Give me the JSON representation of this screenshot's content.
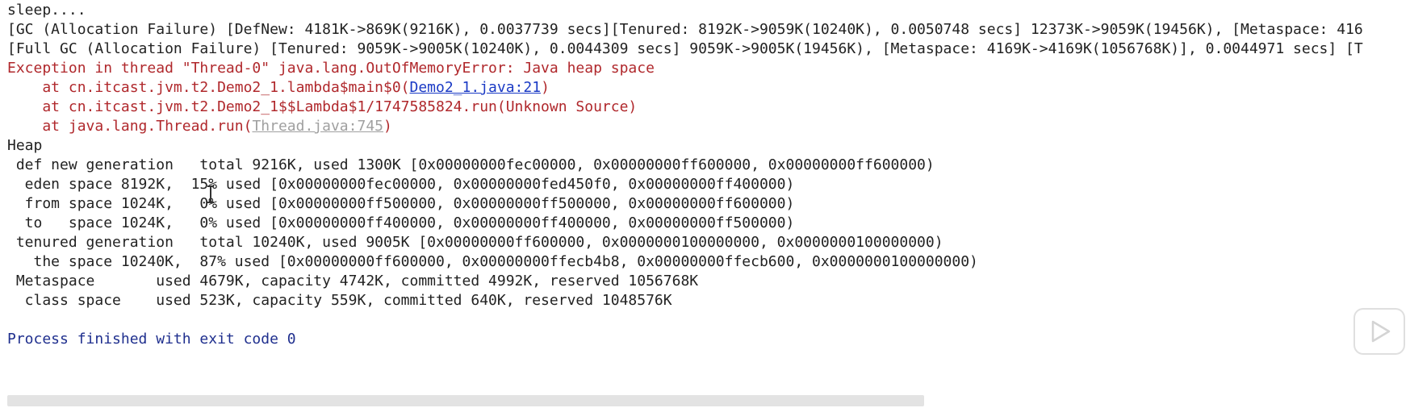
{
  "console": {
    "sleep": "sleep....",
    "gc1": "[GC (Allocation Failure) [DefNew: 4181K->869K(9216K), 0.0037739 secs][Tenured: 8192K->9059K(10240K), 0.0050748 secs] 12373K->9059K(19456K), [Metaspace: 416",
    "gc2": "[Full GC (Allocation Failure) [Tenured: 9059K->9005K(10240K), 0.0044309 secs] 9059K->9005K(19456K), [Metaspace: 4169K->4169K(1056768K)], 0.0044971 secs] [T",
    "exception": "Exception in thread \"Thread-0\" java.lang.OutOfMemoryError: Java heap space",
    "stack1_prefix": "    at cn.itcast.jvm.t2.Demo2_1.lambda$main$0(",
    "stack1_link": "Demo2_1.java:21",
    "stack1_suffix": ")",
    "stack2": "    at cn.itcast.jvm.t2.Demo2_1$$Lambda$1/1747585824.run(Unknown Source)",
    "stack3_prefix": "    at java.lang.Thread.run(",
    "stack3_link": "Thread.java:745",
    "stack3_suffix": ")",
    "heap": "Heap",
    "def_new": " def new generation   total 9216K, used 1300K [0x00000000fec00000, 0x00000000ff600000, 0x00000000ff600000)",
    "eden": "  eden space 8192K,  15% used [0x00000000fec00000, 0x00000000fed450f0, 0x00000000ff400000)",
    "from": "  from space 1024K,   0% used [0x00000000ff500000, 0x00000000ff500000, 0x00000000ff600000)",
    "to": "  to   space 1024K,   0% used [0x00000000ff400000, 0x00000000ff400000, 0x00000000ff500000)",
    "tenured": " tenured generation   total 10240K, used 9005K [0x00000000ff600000, 0x0000000100000000, 0x0000000100000000)",
    "the_space": "   the space 10240K,  87% used [0x00000000ff600000, 0x00000000ffecb4b8, 0x00000000ffecb600, 0x0000000100000000)",
    "metaspace": " Metaspace       used 4679K, capacity 4742K, committed 4992K, reserved 1056768K",
    "class_space": "  class space    used 523K, capacity 559K, committed 640K, reserved 1048576K",
    "process": "Process finished with exit code 0"
  },
  "colors": {
    "error": "#b0282c",
    "process": "#1f2f8e",
    "link": "#1a3ac5",
    "link_muted": "#a0a0a0",
    "text": "#222222"
  },
  "icons": {
    "play_overlay": "play-icon",
    "cursor": "text-cursor-icon"
  }
}
